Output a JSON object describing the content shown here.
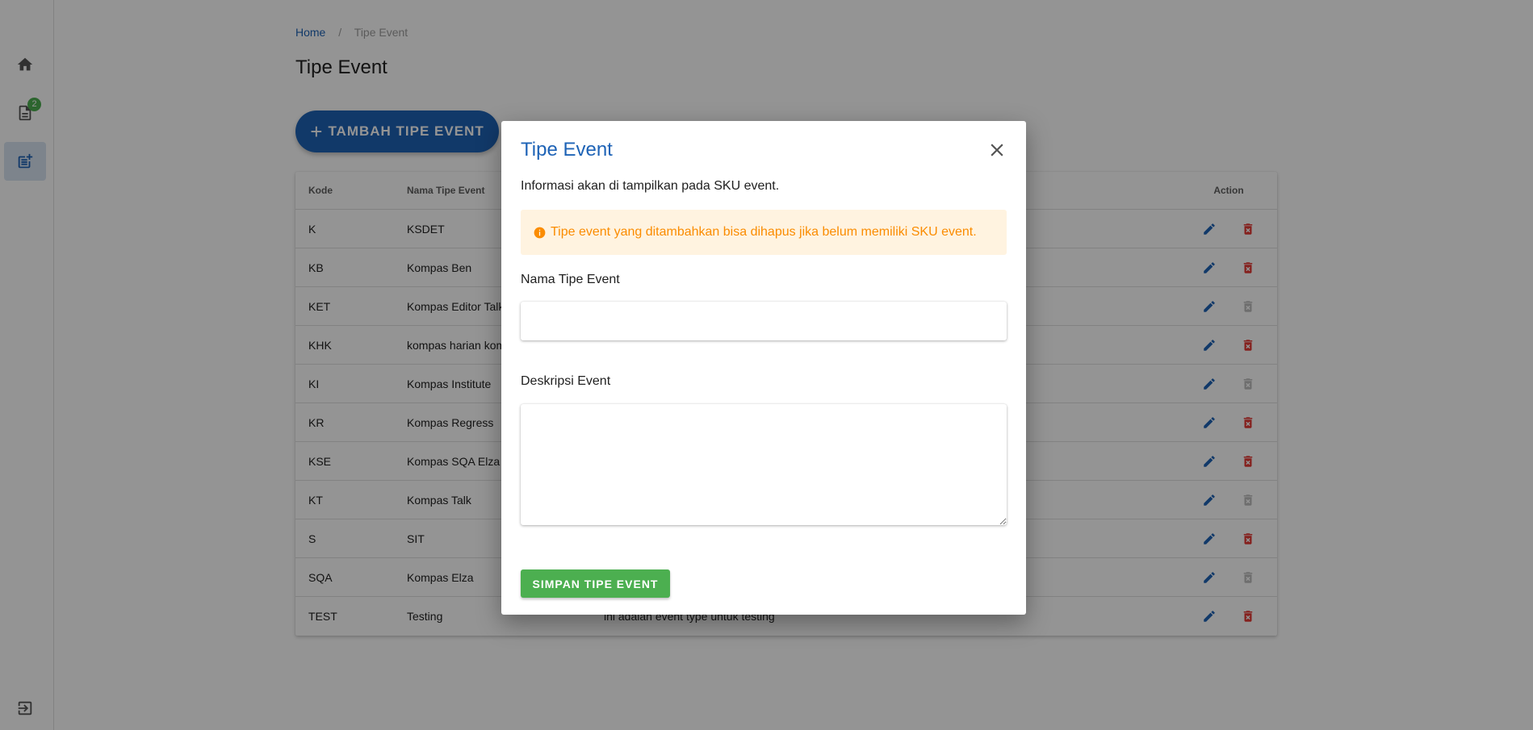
{
  "sidebar": {
    "items": [
      {
        "name": "home",
        "icon": "home-icon"
      },
      {
        "name": "documents",
        "icon": "document-icon",
        "badge": "2"
      },
      {
        "name": "event-types",
        "icon": "post-add-icon"
      }
    ],
    "logout_icon": "logout-icon"
  },
  "breadcrumb": {
    "home": "Home",
    "separator": "/",
    "current": "Tipe Event"
  },
  "page": {
    "title": "Tipe Event",
    "add_button": "TAMBAH TIPE EVENT"
  },
  "table": {
    "columns": [
      "Kode",
      "Nama Tipe Event",
      "",
      "Action"
    ],
    "rows": [
      {
        "kode": "K",
        "nama": "KSDET",
        "deskripsi": "",
        "deletable": true
      },
      {
        "kode": "KB",
        "nama": "Kompas Ben",
        "deskripsi": "",
        "deletable": true
      },
      {
        "kode": "KET",
        "nama": "Kompas Editor Talk",
        "deskripsi": "",
        "deletable": false
      },
      {
        "kode": "KHK",
        "nama": "kompas harian kom",
        "deskripsi": "",
        "deletable": true
      },
      {
        "kode": "KI",
        "nama": "Kompas Institute",
        "deskripsi": "",
        "deletable": false
      },
      {
        "kode": "KR",
        "nama": "Kompas Regress",
        "deskripsi": "",
        "deletable": true
      },
      {
        "kode": "KSE",
        "nama": "Kompas SQA Elza",
        "deskripsi": "",
        "deletable": true
      },
      {
        "kode": "KT",
        "nama": "Kompas Talk",
        "deskripsi": "",
        "deletable": false
      },
      {
        "kode": "S",
        "nama": "SIT",
        "deskripsi": "",
        "deletable": true
      },
      {
        "kode": "SQA",
        "nama": "Kompas Elza",
        "deskripsi": "",
        "deletable": false
      },
      {
        "kode": "TEST",
        "nama": "Testing",
        "deskripsi": "ini adalah event type untuk testing",
        "deletable": true
      }
    ]
  },
  "dialog": {
    "title": "Tipe Event",
    "info": "Informasi akan di tampilkan pada SKU event.",
    "alert": "Tipe event yang ditambahkan bisa dihapus jika belum memiliki SKU event.",
    "nama_label": "Nama Tipe Event",
    "nama_value": "",
    "deskripsi_label": "Deskripsi Event",
    "deskripsi_value": "",
    "save_button": "SIMPAN TIPE EVENT"
  },
  "colors": {
    "primary": "#1e63b6",
    "success": "#4caf50",
    "warning": "#fb8c00",
    "danger": "#e53935",
    "disabled": "#bdbdbd"
  }
}
